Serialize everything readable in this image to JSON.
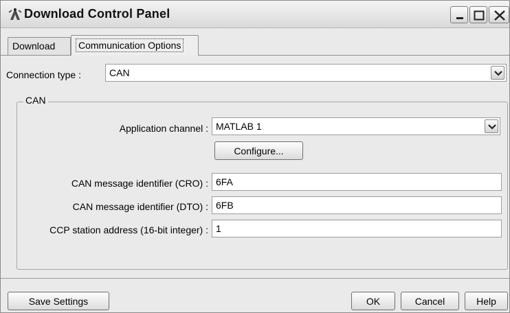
{
  "window": {
    "title": "Download Control Panel",
    "controls": [
      "minimize",
      "maximize",
      "close"
    ]
  },
  "tabs": [
    {
      "label": "Download",
      "active": false
    },
    {
      "label": "Communication Options",
      "active": true
    }
  ],
  "connection": {
    "label": "Connection type :",
    "value": "CAN"
  },
  "can_group": {
    "title": "CAN",
    "application_channel_label": "Application channel :",
    "application_channel_value": "MATLAB 1",
    "configure_label": "Configure...",
    "cro_label": "CAN message identifier (CRO) :",
    "cro_value": "6FA",
    "dto_label": "CAN message identifier (DTO) :",
    "dto_value": "6FB",
    "ccp_label": "CCP station address (16-bit integer) :",
    "ccp_value": "1"
  },
  "footer": {
    "save_label": "Save Settings",
    "ok_label": "OK",
    "cancel_label": "Cancel",
    "help_label": "Help"
  },
  "icons": {
    "app": "antenna-icon",
    "minimize": "minimize-icon",
    "maximize": "maximize-icon",
    "close": "close-icon",
    "dropdown": "chevron-down-icon"
  }
}
